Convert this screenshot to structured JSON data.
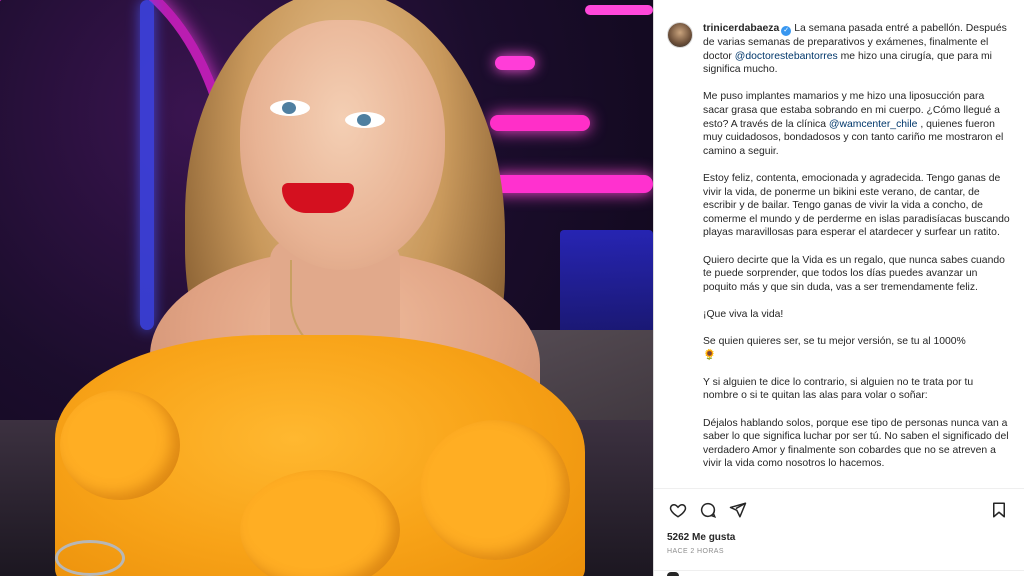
{
  "post": {
    "username": "trinicerdabaeza",
    "verified_icon": "verified-badge-icon",
    "caption": {
      "p1_text1": "La semana pasada entré a pabellón. Después de varias semanas de preparativos y exámenes, finalmente el doctor ",
      "p1_mention": "@doctorestebantorres",
      "p1_text2": " me hizo una cirugía, que para mi significa mucho.",
      "p2_text1": "Me puso implantes mamarios y me hizo una liposucción para sacar grasa que estaba sobrando en mi cuerpo. ¿Cómo llegué a esto? A través de la clínica ",
      "p2_mention": "@wamcenter_chile",
      "p2_text2": " , quienes fueron muy cuidadosos, bondadosos y con tanto cariño me mostraron el camino a seguir.",
      "p3": "Estoy feliz, contenta, emocionada y agradecida. Tengo ganas de vivir la vida, de ponerme un bikini este verano, de cantar, de escribir y de bailar. Tengo ganas de vivir la vida a concho, de comerme el mundo y de perderme en islas paradisíacas buscando playas maravillosas para esperar el atardecer y surfear un ratito.",
      "p4": "Quiero decirte que la Vida es un regalo, que nunca sabes cuando te puede sorprender, que todos los días puedes avanzar un poquito más y que sin duda, vas a ser tremendamente feliz.",
      "p5": "¡Que viva la vida!",
      "p6_line1": "Se quien quieres ser, se tu mejor versión, se tu al 1000%",
      "p6_line2": "🌻",
      "p7": "Y si alguien te dice lo contrario, si alguien no te trata por tu nombre o si te quitan las alas para volar o soñar:",
      "p8": "Déjalos hablando solos, porque ese tipo de personas nunca van a saber lo que significa luchar por ser tú. No saben el significado del verdadero Amor y finalmente son cobardes que no se atreven a vivir la vida como nosotros lo hacemos."
    },
    "likes_count": "5262",
    "likes_label": "Me gusta",
    "timestamp": "HACE 2 HORAS",
    "icons": {
      "like": "heart-icon",
      "comment": "comment-icon",
      "share": "share-icon",
      "save": "bookmark-icon"
    },
    "colors": {
      "mention": "#00376b",
      "verified": "#3897f0",
      "text": "#262626",
      "muted": "#8e8e8e"
    }
  }
}
